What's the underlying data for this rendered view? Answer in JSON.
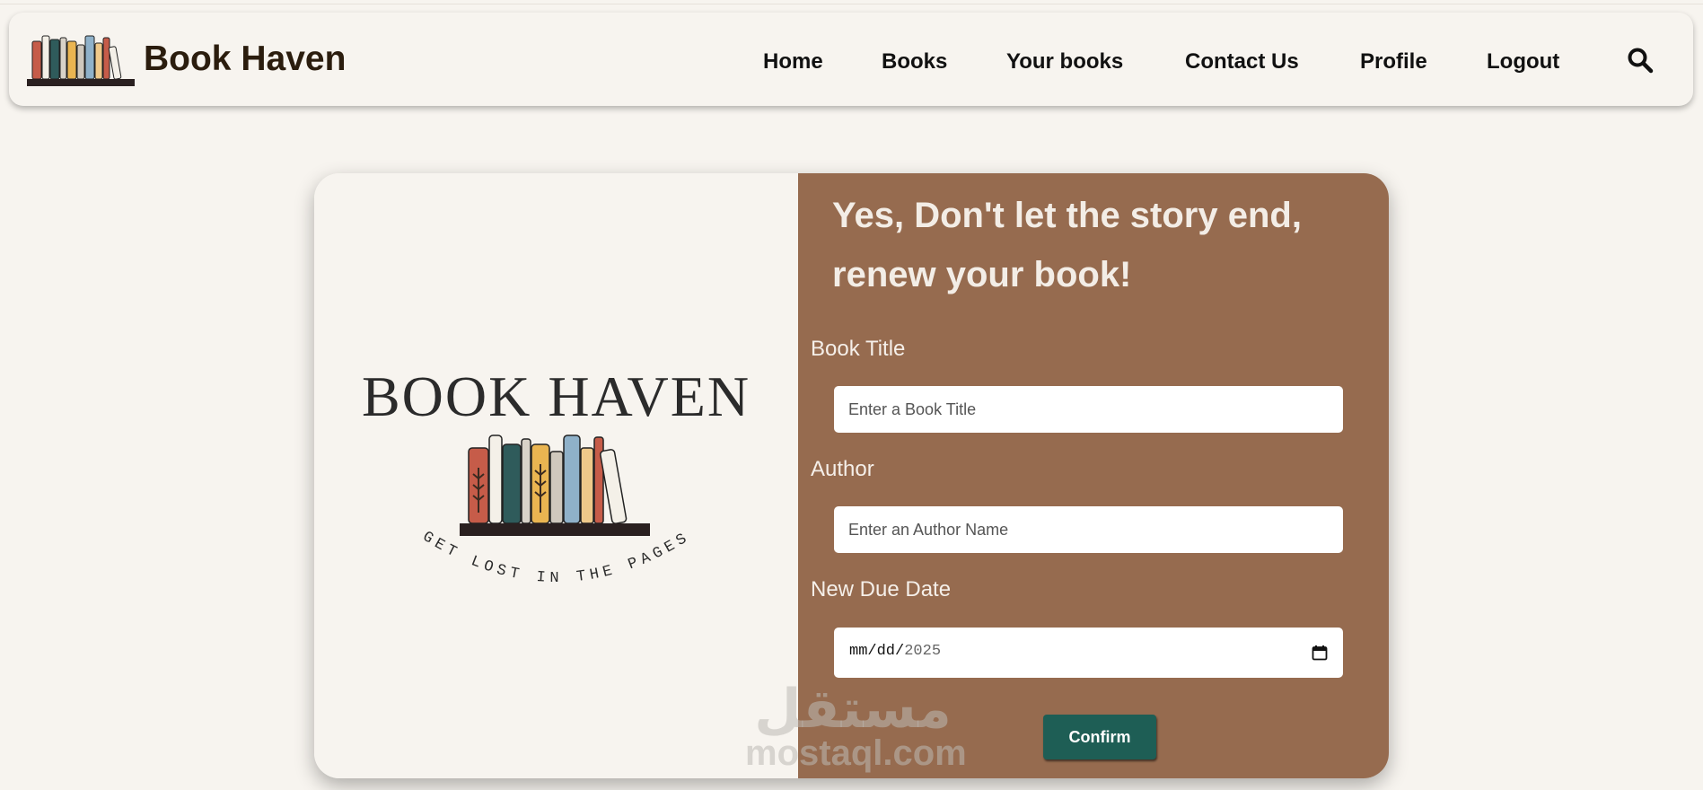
{
  "brand": {
    "name": "Book Haven"
  },
  "nav": {
    "items": [
      {
        "label": "Home"
      },
      {
        "label": "Books"
      },
      {
        "label": "Your books"
      },
      {
        "label": "Contact Us"
      },
      {
        "label": "Profile"
      },
      {
        "label": "Logout"
      }
    ],
    "search_icon": "search-icon"
  },
  "logo": {
    "title": "BOOK HAVEN",
    "tagline": "GET LOST IN THE PAGES"
  },
  "form": {
    "heading": "Yes, Don't let the story end, renew your book!",
    "book_title": {
      "label": "Book Title",
      "placeholder": "Enter a Book Title",
      "value": ""
    },
    "author": {
      "label": "Author",
      "placeholder": "Enter an Author Name",
      "value": ""
    },
    "due_date": {
      "label": "New Due Date",
      "mask": "mm/dd/",
      "year": "2025"
    },
    "confirm_label": "Confirm"
  },
  "watermark": {
    "arabic": "مستقل",
    "latin": "mostaql.com"
  },
  "colors": {
    "background": "#f7f4ef",
    "panel_brown": "#966b4f",
    "button_green": "#1e5e55",
    "text_dark": "#2b1d0e"
  }
}
